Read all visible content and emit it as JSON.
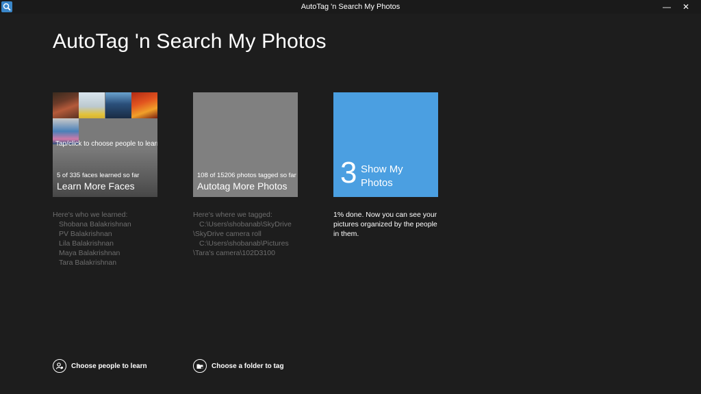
{
  "window": {
    "title": "AutoTag 'n Search My Photos",
    "minimize": "—",
    "close": "✕"
  },
  "page": {
    "title": "AutoTag 'n Search My Photos"
  },
  "tiles": {
    "faces": {
      "hint": "Tap/click to choose people to learn",
      "progress": "5 of 335 faces learned so far",
      "label": "Learn More Faces"
    },
    "tag": {
      "progress": "108 of 15206 photos tagged so far",
      "label": "Autotag More Photos"
    },
    "show": {
      "number": "3",
      "label": "Show My Photos",
      "color": "#4b9fe1"
    }
  },
  "faces_info": {
    "heading": "Here's who we learned:",
    "people": [
      "Shobana Balakrishnan",
      "PV Balakrishnan",
      "Lila Balakrishnan",
      "Maya Balakrishnan",
      "Tara Balakrishnan"
    ]
  },
  "tag_info": {
    "heading": "Here's where we tagged:",
    "lines": [
      "C:\\Users\\shobanab\\SkyDrive",
      "\\SkyDrive camera roll",
      "C:\\Users\\shobanab\\Pictures",
      "\\Tara's camera\\102D3100"
    ]
  },
  "show_info": {
    "text": "1% done. Now you can see your pictures organized by the people in them."
  },
  "appbar": {
    "choose_people": "Choose people to learn",
    "choose_folder": "Choose a folder to tag"
  },
  "icons": {
    "app": "app-search-icon",
    "people": "person-add-icon",
    "folder": "folder-tag-icon"
  }
}
